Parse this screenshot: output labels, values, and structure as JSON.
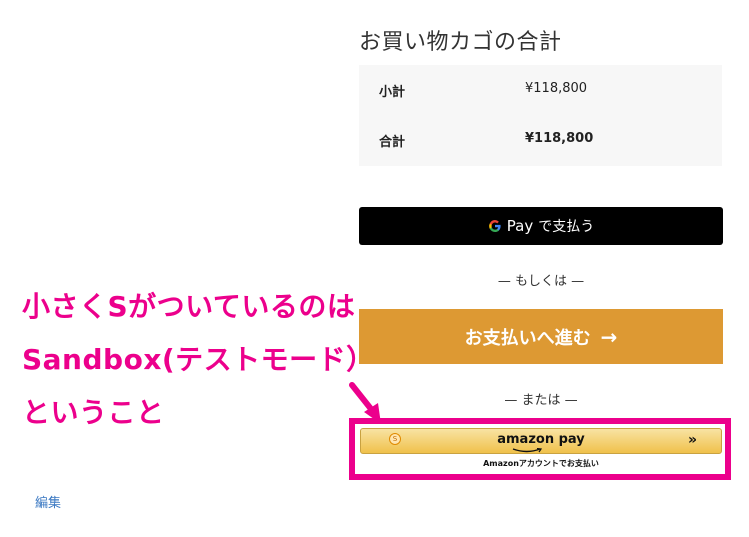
{
  "cart_totals": {
    "title": "お買い物カゴの合計",
    "rows": [
      {
        "label": "小計",
        "value": "¥118,800"
      },
      {
        "label": "合計",
        "value": "¥118,800"
      }
    ]
  },
  "gpay": {
    "word": "Pay",
    "suffix": "で支払う"
  },
  "divider_or": "— もしくは —",
  "checkout": {
    "label": "お支払いへ進む",
    "arrow": "→"
  },
  "divider_mata": "— または —",
  "amazon_pay": {
    "badge": "S",
    "logo": "amazon pay",
    "chevron": "»",
    "caption": "Amazonアカウントでお支払い"
  },
  "annotation": {
    "lines": [
      "小さくSがついているのは",
      "Sandbox(テストモード）",
      "ということ"
    ],
    "color": "#ec008c"
  },
  "edit_link": "編集",
  "colors": {
    "accent_pink": "#ec008c",
    "checkout_orange": "#dd9933",
    "amazon_gold": "#f0c14b",
    "link_blue": "#3a78c2"
  }
}
